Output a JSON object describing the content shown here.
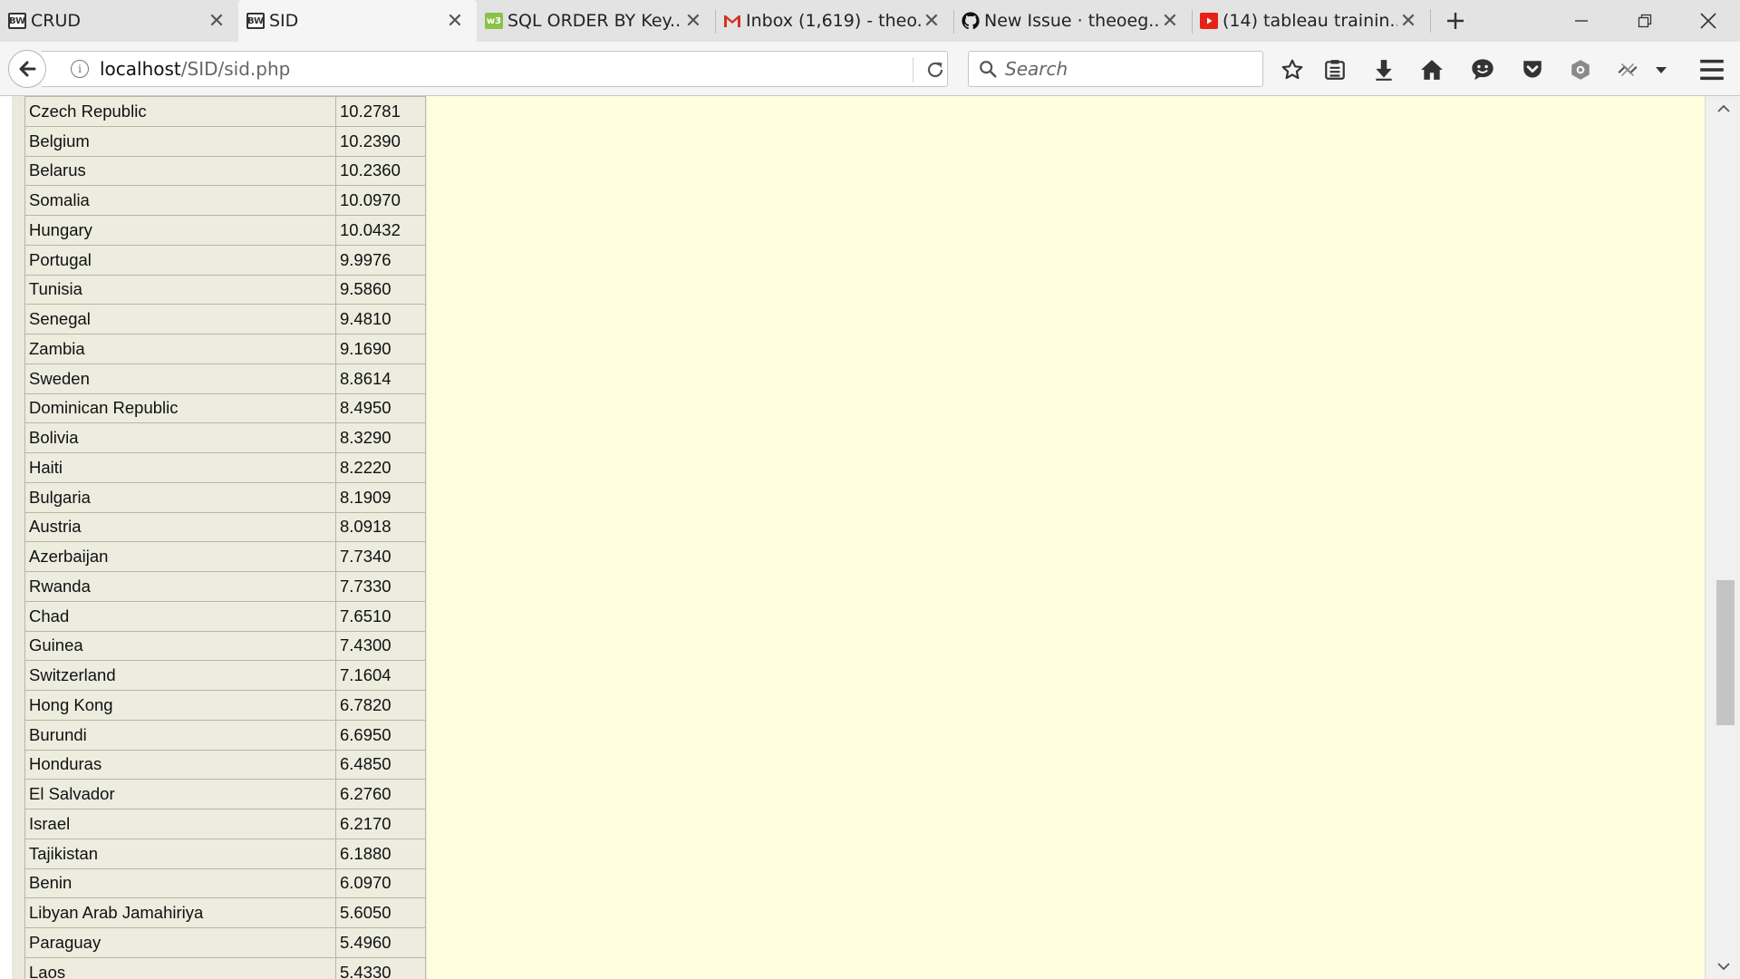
{
  "browser": {
    "tabs": [
      {
        "title": "CRUD",
        "favicon": "bw-icon"
      },
      {
        "title": "SID",
        "favicon": "bw-icon",
        "active": true
      },
      {
        "title": "SQL ORDER BY Key...",
        "favicon": "w3schools-icon"
      },
      {
        "title": "Inbox (1,619) - theo...",
        "favicon": "gmail-icon"
      },
      {
        "title": "New Issue · theoeg...",
        "favicon": "github-icon"
      },
      {
        "title": "(14) tableau trainin...",
        "favicon": "youtube-icon"
      }
    ],
    "url_host": "localhost",
    "url_path": "/SID/sid.php",
    "search_placeholder": "Search",
    "colors": {
      "pane": "#ffffdd",
      "table": "#ececdf",
      "youtube": "#e62117",
      "w3schools": "#8ac249"
    }
  },
  "table": {
    "rows": [
      {
        "country": "Czech Republic",
        "value": "10.2781"
      },
      {
        "country": "Belgium",
        "value": "10.2390"
      },
      {
        "country": "Belarus",
        "value": "10.2360"
      },
      {
        "country": "Somalia",
        "value": "10.0970"
      },
      {
        "country": "Hungary",
        "value": "10.0432"
      },
      {
        "country": "Portugal",
        "value": "9.9976"
      },
      {
        "country": "Tunisia",
        "value": "9.5860"
      },
      {
        "country": "Senegal",
        "value": "9.4810"
      },
      {
        "country": "Zambia",
        "value": "9.1690"
      },
      {
        "country": "Sweden",
        "value": "8.8614"
      },
      {
        "country": "Dominican Republic",
        "value": "8.4950"
      },
      {
        "country": "Bolivia",
        "value": "8.3290"
      },
      {
        "country": "Haiti",
        "value": "8.2220"
      },
      {
        "country": "Bulgaria",
        "value": "8.1909"
      },
      {
        "country": "Austria",
        "value": "8.0918"
      },
      {
        "country": "Azerbaijan",
        "value": "7.7340"
      },
      {
        "country": "Rwanda",
        "value": "7.7330"
      },
      {
        "country": "Chad",
        "value": "7.6510"
      },
      {
        "country": "Guinea",
        "value": "7.4300"
      },
      {
        "country": "Switzerland",
        "value": "7.1604"
      },
      {
        "country": "Hong Kong",
        "value": "6.7820"
      },
      {
        "country": "Burundi",
        "value": "6.6950"
      },
      {
        "country": "Honduras",
        "value": "6.4850"
      },
      {
        "country": "El Salvador",
        "value": "6.2760"
      },
      {
        "country": "Israel",
        "value": "6.2170"
      },
      {
        "country": "Tajikistan",
        "value": "6.1880"
      },
      {
        "country": "Benin",
        "value": "6.0970"
      },
      {
        "country": "Libyan Arab Jamahiriya",
        "value": "5.6050"
      },
      {
        "country": "Paraguay",
        "value": "5.4960"
      },
      {
        "country": "Laos",
        "value": "5.4330"
      }
    ]
  }
}
